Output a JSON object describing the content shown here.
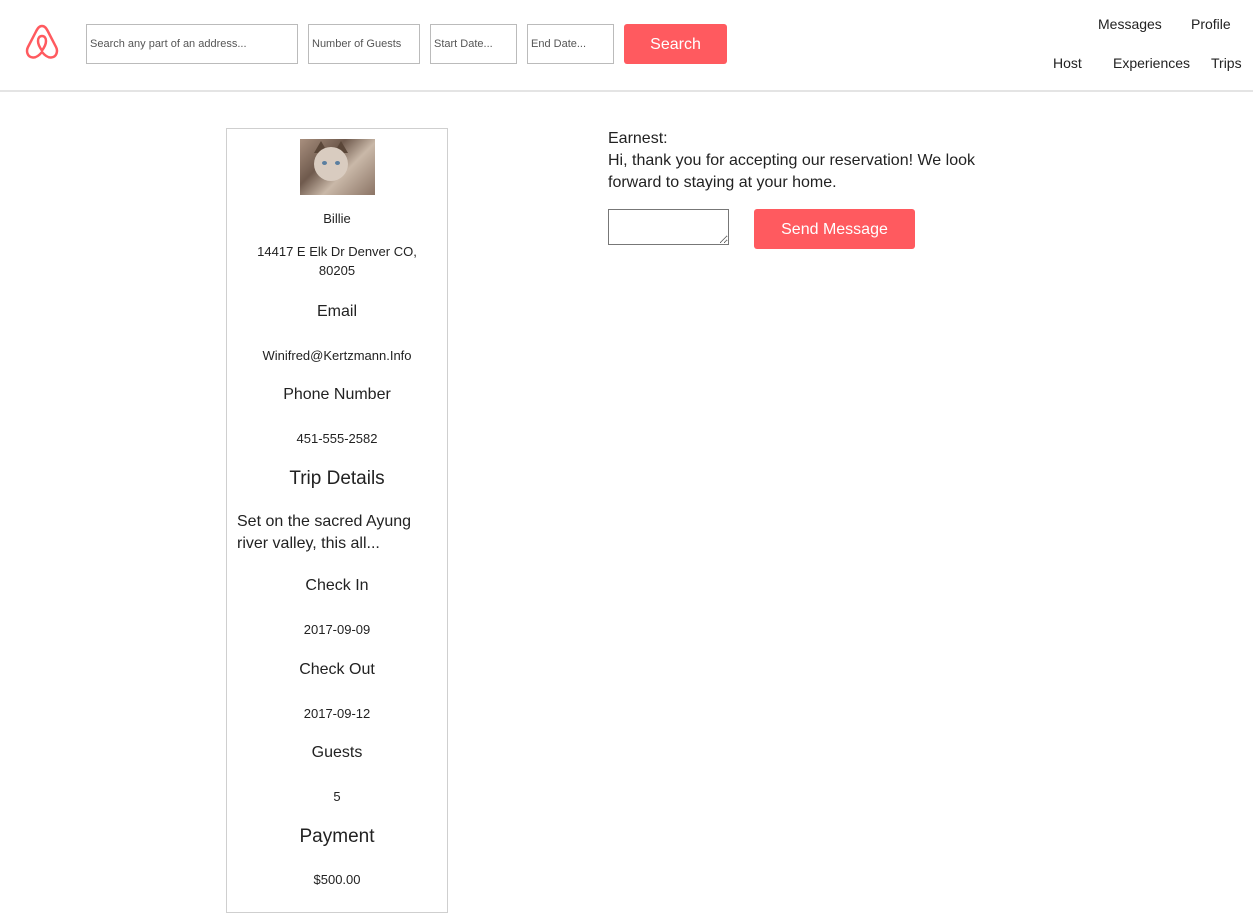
{
  "header": {
    "search_placeholder": "Search any part of an address...",
    "guests_placeholder": "Number of Guests",
    "start_placeholder": "Start Date...",
    "end_placeholder": "End Date...",
    "search_button": "Search",
    "nav": {
      "messages": "Messages",
      "profile": "Profile",
      "host": "Host",
      "experiences": "Experiences",
      "trips": "Trips"
    },
    "logo_icon": "airbnb-logo-icon"
  },
  "guest_card": {
    "avatar_icon": "cat-photo",
    "name": "Billie",
    "address": "14417 E Elk Dr Denver CO, 80205",
    "email_label": "Email",
    "email": "Winifred@Kertzmann.Info",
    "phone_label": "Phone Number",
    "phone": "451-555-2582",
    "trip_details_label": "Trip Details",
    "trip_description": "Set on the sacred Ayung river valley, this all...",
    "check_in_label": "Check In",
    "check_in": "2017-09-09",
    "check_out_label": "Check Out",
    "check_out": "2017-09-12",
    "guests_label": "Guests",
    "guests": "5",
    "payment_label": "Payment",
    "payment": "$500.00"
  },
  "messages": {
    "author": "Earnest:",
    "text": "Hi, thank you for accepting our reservation! We look forward to staying at your home.",
    "input_value": "",
    "send_button": "Send Message"
  },
  "colors": {
    "accent": "#ff5a5f"
  }
}
